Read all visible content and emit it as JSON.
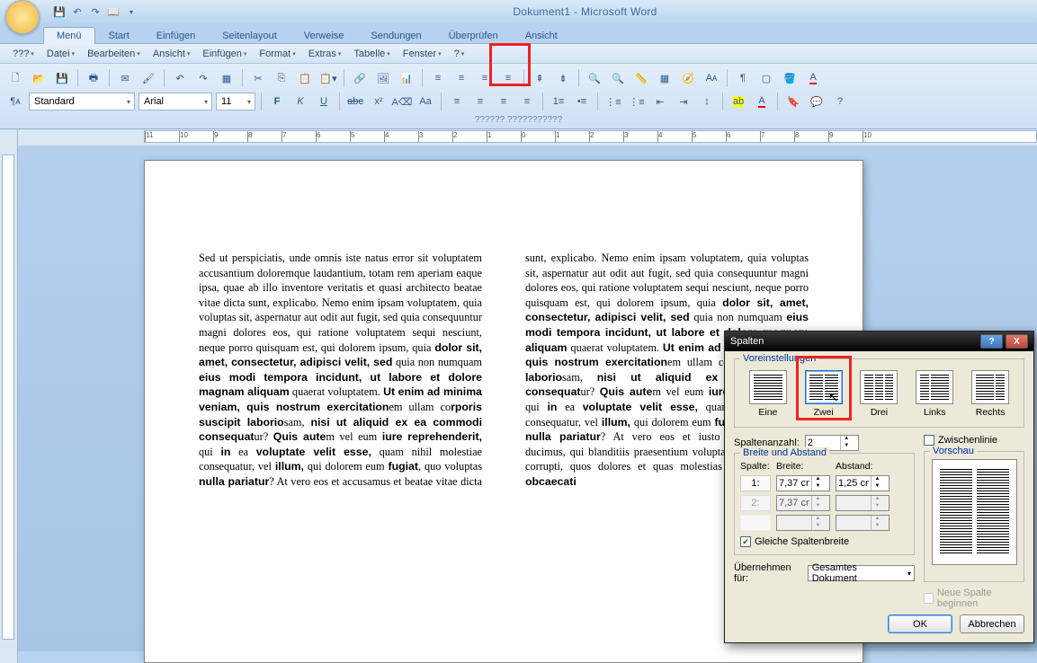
{
  "title": "Dokument1 - Microsoft Word",
  "tabs": [
    "Menü",
    "Start",
    "Einfügen",
    "Seitenlayout",
    "Verweise",
    "Sendungen",
    "Überprüfen",
    "Ansicht"
  ],
  "classic_menu": [
    "???",
    "Datei",
    "Bearbeiten",
    "Ansicht",
    "Einfügen",
    "Format",
    "Extras",
    "Tabelle",
    "Fenster",
    "?"
  ],
  "style_value": "Standard",
  "font_value": "Arial",
  "size_value": "11",
  "status_hint": "?????? ???????????",
  "dialog": {
    "title": "Spalten",
    "fs_presets": "Voreinstellungen",
    "presets": [
      {
        "name": "Eine",
        "cols": 1
      },
      {
        "name": "Zwei",
        "cols": 2
      },
      {
        "name": "Drei",
        "cols": 3
      },
      {
        "name": "Links",
        "cols": 2
      },
      {
        "name": "Rechts",
        "cols": 2
      }
    ],
    "spaltenanzahl_lbl": "Spaltenanzahl:",
    "spaltenanzahl_val": "2",
    "zwischenlinie": "Zwischenlinie",
    "fs_breite": "Breite und Abstand",
    "spalte_hdr": "Spalte:",
    "breite_hdr": "Breite:",
    "abstand_hdr": "Abstand:",
    "r1": {
      "n": "1:",
      "b": "7,37 cm",
      "a": "1,25 cm"
    },
    "r2": {
      "n": "2:",
      "b": "7,37 cm",
      "a": ""
    },
    "gleiche": "Gleiche Spaltenbreite",
    "vorschau": "Vorschau",
    "uebernehmen_lbl": "Übernehmen für:",
    "uebernehmen_val": "Gesamtes Dokument",
    "neue_spalte": "Neue Spalte beginnen",
    "ok": "OK",
    "cancel": "Abbrechen"
  },
  "body_html": "Sed ut perspiciatis, unde omnis iste natus error sit voluptatem accusantium doloremque laudantium, totam rem aperiam eaque ipsa, quae ab illo inventore veritatis et quasi architecto beatae vitae dicta sunt, explicabo. Nemo enim ipsam voluptatem, quia voluptas sit, aspernatur aut odit aut fugit, sed quia consequuntur magni dolores eos, qui ratione voluptatem sequi nesciunt, neque porro quisquam est, qui dolorem ipsum, quia <b>dolor sit, amet, consectetur, adipisci velit, sed</b> quia non numquam <b>eius modi tempora incidunt, ut labore et dolore magnam aliquam</b> quaerat voluptatem. <b>Ut enim ad minima veniam, quis nostrum exercitation</b>em ullam co<b>rporis suscipit laborio</b>sam, <b>nisi ut aliquid ex ea commodi consequat</b>ur? <b>Quis aute</b>m vel eum <b>iure reprehenderit,</b> qui <b>in</b> ea <b>voluptate velit esse,</b> quam nihil molestiae consequatur, vel <b>illum,</b> qui dolorem eum <b>fugiat</b>, quo voluptas <b>nulla pariatur</b>? At vero eos et accusamus et beatae vitae dicta sunt, explicabo. Nemo enim ipsam voluptatem, quia voluptas sit, aspernatur aut odit aut fugit, sed quia consequuntur magni dolores eos, qui ratione voluptatem sequi nesciunt, neque porro quisquam est, qui dolorem ipsum, quia <b>dolor sit, amet, consectetur, adipisci velit, sed</b> quia non numquam <b>eius modi tempora incidunt, ut labore et dolore magnam aliquam</b> quaerat voluptatem. <b>Ut enim ad minima veniam, quis nostrum exercitation</b>em ullam co<b>rporis suscipit laborio</b>sam, <b>nisi ut aliquid ex ea commodi consequat</b>ur? <b>Quis aute</b>m vel eum <b>iure reprehenderit,</b> qui <b>in</b> ea <b>voluptate velit esse,</b> quam nihil molestiae consequatur, vel <b>illum,</b> qui dolorem eum <b>fugiat</b>, quo voluptas <b>nulla pariatur</b>? At vero eos et iusto odio dignissimos ducimus, qui blanditiis praesentium voluptatum deleniti atque corrupti, quos dolores et quas molestias <b>excepturi sint, obcaecati</b>"
}
